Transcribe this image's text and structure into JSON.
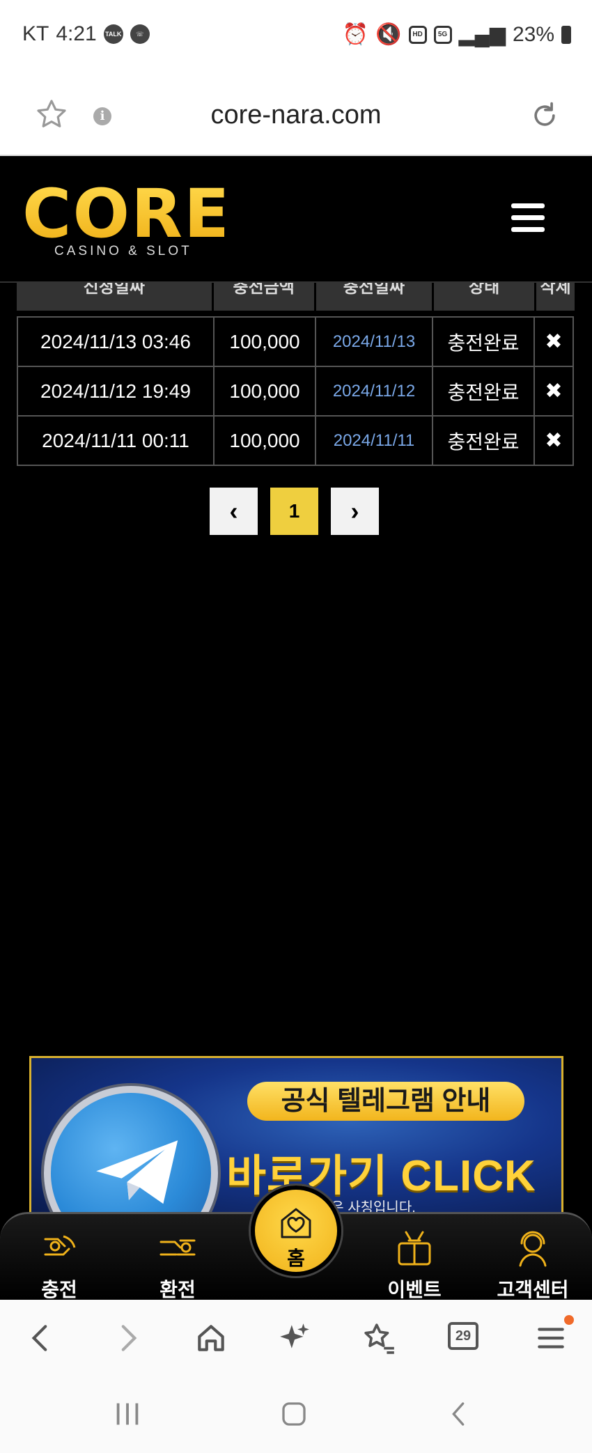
{
  "status_bar": {
    "carrier": "KT",
    "time": "4:21",
    "network": "5G",
    "hd": "HD",
    "battery": "23%"
  },
  "browser": {
    "url": "core-nara.com",
    "tabs_count": "29"
  },
  "site": {
    "logo_main": "CORE",
    "logo_sub": "CASINO & SLOT",
    "brand_colors": {
      "gold": "#f0b21a",
      "ring": "#4ea0c8"
    }
  },
  "table": {
    "headers": [
      "신청일짜",
      "충전금액",
      "충전일짜",
      "상태",
      "삭제"
    ],
    "rows": [
      {
        "requested": "2024/11/13 03:46",
        "amount": "100,000",
        "charged": "2024/11/13",
        "status": "충전완료",
        "delete": "✖"
      },
      {
        "requested": "2024/11/12 19:49",
        "amount": "100,000",
        "charged": "2024/11/12",
        "status": "충전완료",
        "delete": "✖"
      },
      {
        "requested": "2024/11/11 00:11",
        "amount": "100,000",
        "charged": "2024/11/11",
        "status": "충전완료",
        "delete": "✖"
      }
    ]
  },
  "pagination": {
    "prev": "‹",
    "current": "1",
    "next": "›"
  },
  "banner": {
    "pill": "공식 텔레그램 안내",
    "cta": "바로가기 CLICK",
    "note": "…외 봇, 채널은 사칭입니다."
  },
  "bottom_nav": {
    "charge": "충전",
    "exchange": "환전",
    "home": "홈",
    "event": "이벤트",
    "support": "고객센터"
  }
}
